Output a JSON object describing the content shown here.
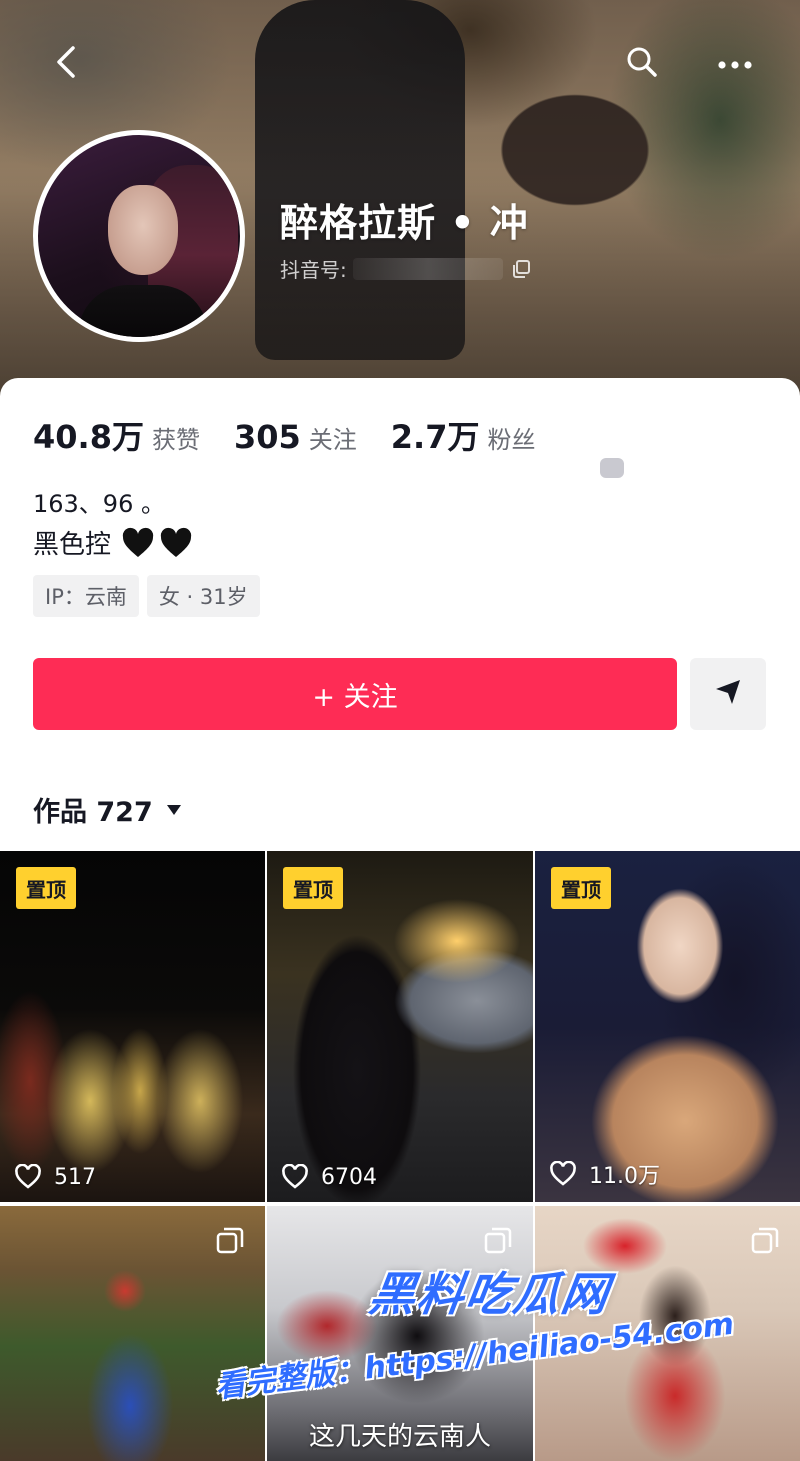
{
  "header": {
    "nickname": "醉格拉斯 • 冲",
    "douyin_id_label": "抖音号:",
    "icons": {
      "back": "back-chevron-icon",
      "search": "search-icon",
      "more": "more-dots-icon",
      "copy": "copy-icon"
    }
  },
  "stats": [
    {
      "value": "40.8万",
      "label": "获赞"
    },
    {
      "value": "305",
      "label": "关注"
    },
    {
      "value": "2.7万",
      "label": "粉丝"
    }
  ],
  "bio": {
    "line1": "163、96 。",
    "line2": "黑色控",
    "emoji": "🖤🖤"
  },
  "tags": [
    "IP：云南",
    "女 · 31岁"
  ],
  "actions": {
    "follow_label": "+ 关注",
    "message_icon": "send-arrow-icon"
  },
  "works": {
    "title": "作品 727",
    "pinned_label": "置顶",
    "tiles": [
      {
        "pinned": true,
        "likes": "517"
      },
      {
        "pinned": true,
        "likes": "6704"
      },
      {
        "pinned": true,
        "likes": "11.0万"
      },
      {
        "pinned": false,
        "multi": true,
        "caption": ""
      },
      {
        "pinned": false,
        "multi": true,
        "caption": "这几天的云南人"
      },
      {
        "pinned": false,
        "multi": true,
        "caption": ""
      }
    ]
  },
  "watermark": {
    "brand": "黑料吃瓜网",
    "url": "看完整版：https://heiliao-54.com"
  },
  "colors": {
    "accent": "#fe2c55",
    "pin_badge": "#ffd02e",
    "watermark": "#2f6dff"
  }
}
